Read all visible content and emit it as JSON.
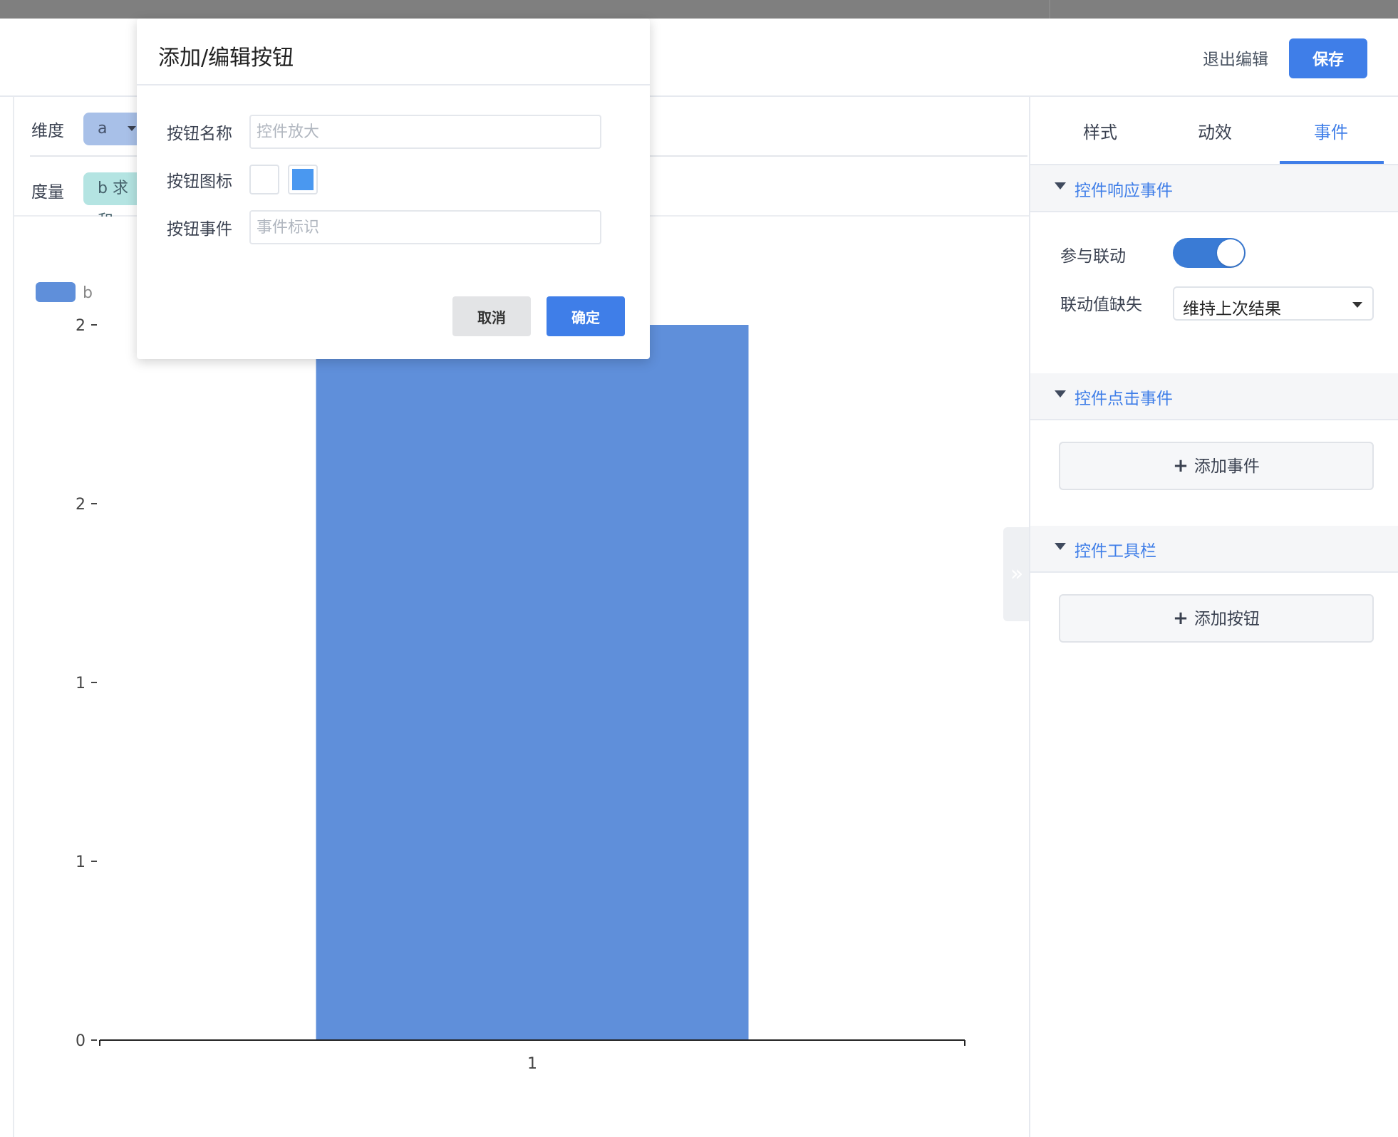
{
  "header": {
    "exit_label": "退出编辑",
    "save_label": "保存"
  },
  "fields": {
    "dimension_label": "维度",
    "dimension_pill": "a",
    "measure_label": "度量",
    "measure_pill": "b 求和"
  },
  "right_panel": {
    "tabs": [
      {
        "label": "样式"
      },
      {
        "label": "动效"
      },
      {
        "label": "事件",
        "active": true
      }
    ],
    "sections": {
      "response": {
        "title": "控件响应事件",
        "linkage_label": "参与联动",
        "linkage_on": true,
        "missing_label": "联动值缺失",
        "missing_value": "维持上次结果"
      },
      "click": {
        "title": "控件点击事件",
        "add_label": "添加事件"
      },
      "toolbar": {
        "title": "控件工具栏",
        "add_label": "添加按钮"
      }
    }
  },
  "modal": {
    "title": "添加/编辑按钮",
    "name_label": "按钮名称",
    "name_placeholder": "控件放大",
    "name_value": "",
    "icon_label": "按钮图标",
    "icon_color": "#4a98f0",
    "event_label": "按钮事件",
    "event_placeholder": "事件标识",
    "event_value": "",
    "cancel_label": "取消",
    "ok_label": "确定"
  },
  "chart_data": {
    "type": "bar",
    "categories": [
      "1"
    ],
    "series": [
      {
        "name": "b",
        "values": [
          2
        ]
      }
    ],
    "ylim": [
      0,
      2
    ],
    "ytick_labels": [
      "0",
      "1",
      "1",
      "2",
      "2"
    ],
    "color": "#5f8fda",
    "legend_position": "top-left",
    "grid": false
  }
}
